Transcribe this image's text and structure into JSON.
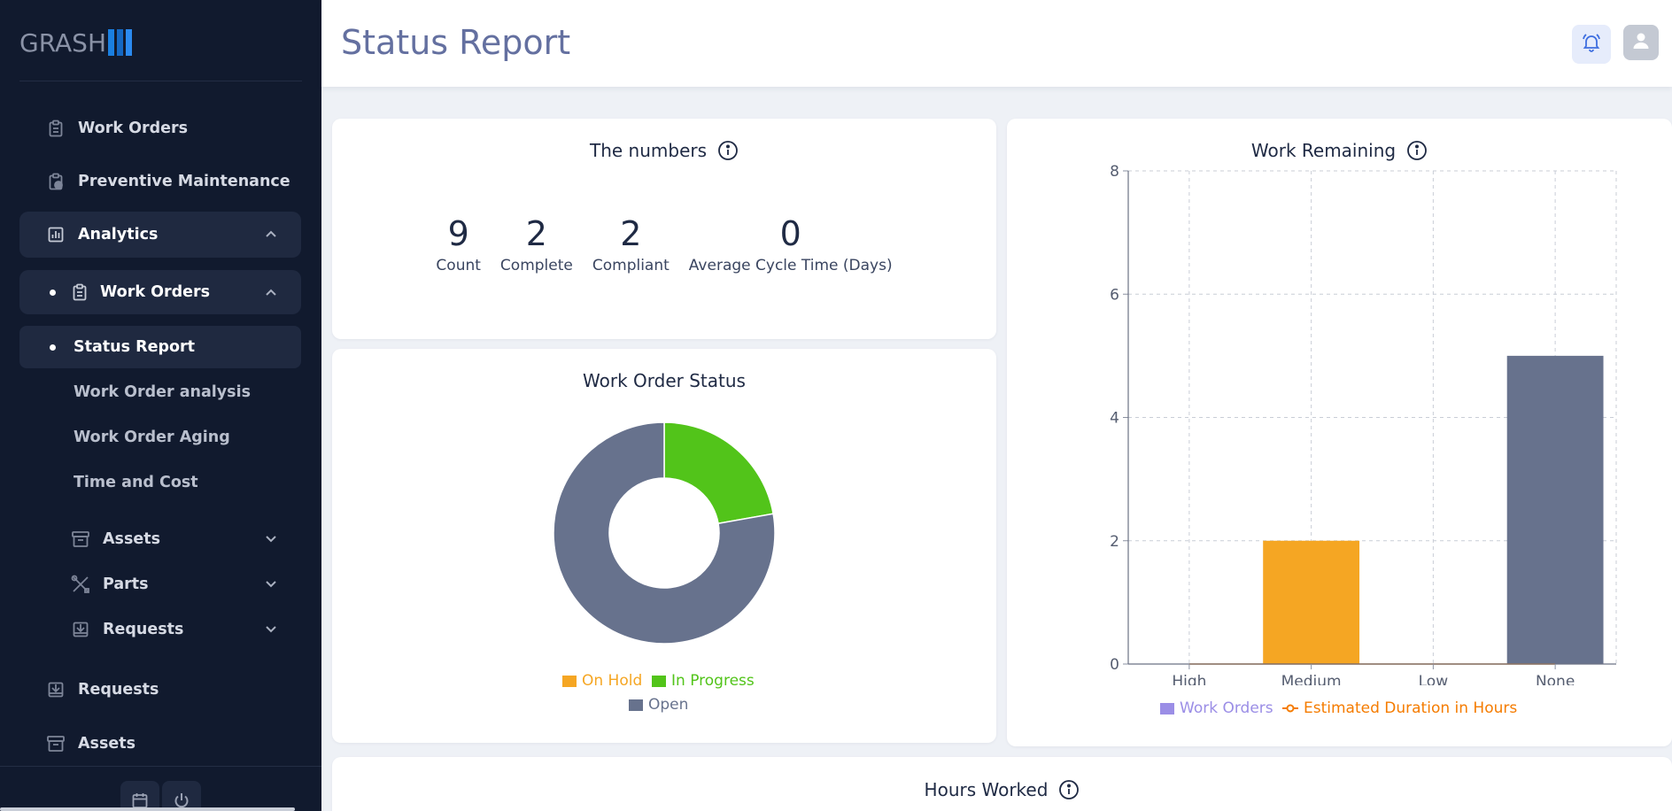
{
  "app": {
    "logo_text": "GRASH",
    "page_title": "Status Report"
  },
  "sidebar": {
    "items": [
      {
        "label": "Work Orders",
        "icon": "clipboard-icon"
      },
      {
        "label": "Preventive Maintenance",
        "icon": "clipboard-clock-icon"
      },
      {
        "label": "Analytics",
        "icon": "bar-chart-icon"
      },
      {
        "label": "Work Orders",
        "icon": "clipboard-icon"
      },
      {
        "label": "Status Report"
      },
      {
        "label": "Work Order analysis"
      },
      {
        "label": "Work Order Aging"
      },
      {
        "label": "Time and Cost"
      },
      {
        "label": "Assets",
        "icon": "archive-icon"
      },
      {
        "label": "Parts",
        "icon": "tools-icon"
      },
      {
        "label": "Requests",
        "icon": "inbox-icon"
      },
      {
        "label": "Requests",
        "icon": "inbox-icon"
      },
      {
        "label": "Assets",
        "icon": "archive-icon"
      }
    ]
  },
  "numbers_card": {
    "title": "The numbers",
    "stats": [
      {
        "value": "9",
        "label": "Count"
      },
      {
        "value": "2",
        "label": "Complete"
      },
      {
        "value": "2",
        "label": "Compliant"
      },
      {
        "value": "0",
        "label": "Average Cycle Time (Days)"
      }
    ]
  },
  "status_card": {
    "title": "Work Order Status",
    "legend": [
      {
        "label": "On Hold",
        "color": "#f5a623"
      },
      {
        "label": "In Progress",
        "color": "#52c41a"
      },
      {
        "label": "Open",
        "color": "#67728d"
      }
    ]
  },
  "remaining_card": {
    "title": "Work Remaining",
    "legend": [
      {
        "label": "Work Orders",
        "color": "#9b8ee6"
      },
      {
        "label": "Estimated Duration in Hours",
        "color": "#f57c00"
      }
    ]
  },
  "hours_card": {
    "title": "Hours Worked"
  },
  "chart_data": [
    {
      "type": "pie",
      "title": "Work Order Status",
      "donut": true,
      "categories": [
        "On Hold",
        "In Progress",
        "Open"
      ],
      "values": [
        0,
        2,
        7
      ],
      "colors": [
        "#f5a623",
        "#52c41a",
        "#67728d"
      ],
      "legend_position": "bottom"
    },
    {
      "type": "bar",
      "title": "Work Remaining",
      "categories": [
        "High",
        "Medium",
        "Low",
        "None"
      ],
      "yticks": [
        0,
        2,
        4,
        6,
        8
      ],
      "ylim": [
        0,
        8
      ],
      "grid": true,
      "legend_position": "bottom",
      "series": [
        {
          "name": "Work Orders",
          "values": [
            0,
            2,
            0,
            5
          ],
          "bar_colors": [
            "#f5a623",
            "#f5a623",
            "#f5a623",
            "#67728d"
          ]
        },
        {
          "name": "Estimated Duration in Hours",
          "type": "line",
          "values": [
            0,
            0,
            0,
            0
          ],
          "color": "#f57c00"
        }
      ]
    }
  ]
}
